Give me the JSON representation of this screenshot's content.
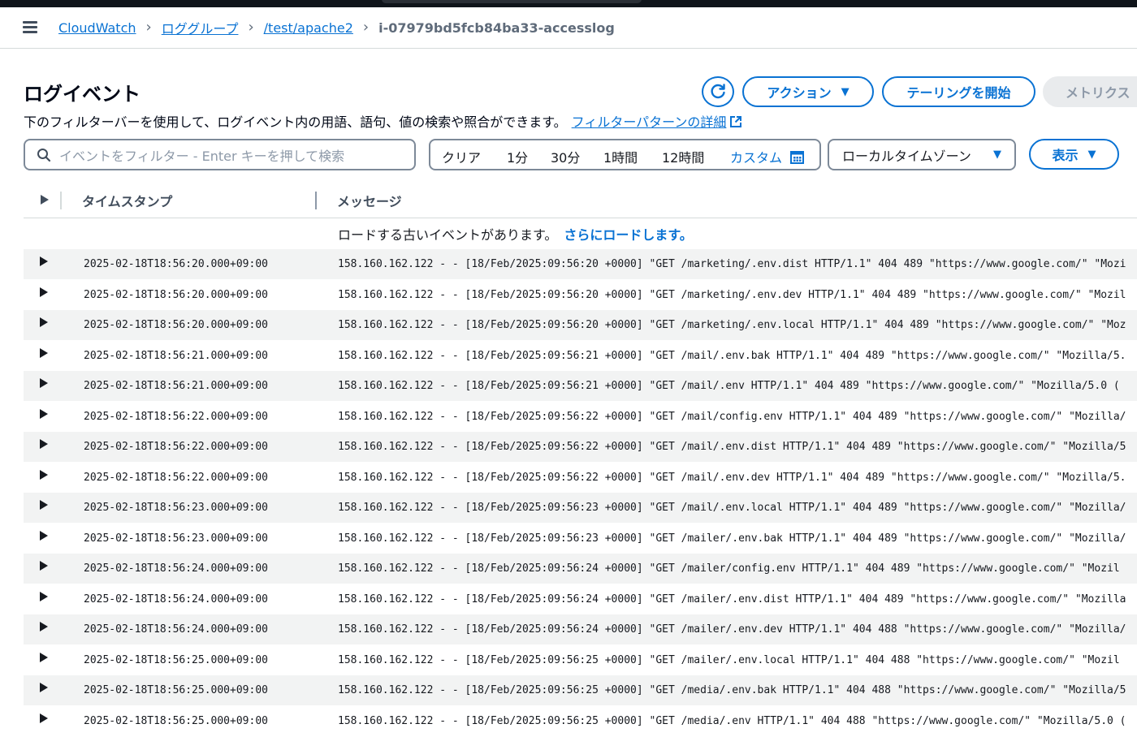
{
  "breadcrumb": {
    "items": [
      "CloudWatch",
      "ロググループ",
      "/test/apache2"
    ],
    "current": "i-07979bd5fcb84ba33-accesslog"
  },
  "page": {
    "title": "ログイベント",
    "description": "下のフィルターバーを使用して、ログイベント内の用語、語句、値の検索や照合ができます。",
    "filter_link": "フィルターパターンの詳細"
  },
  "toolbar": {
    "action_label": "アクション",
    "tail_label": "テーリングを開始",
    "metric_label": "メトリクス"
  },
  "filter": {
    "search_placeholder": "イベントをフィルター - Enter キーを押して検索",
    "range_options": [
      "クリア",
      "1分",
      "30分",
      "1時間",
      "12時間"
    ],
    "custom_label": "カスタム",
    "timezone": "ローカルタイムゾーン",
    "view_label": "表示"
  },
  "table": {
    "col_timestamp": "タイムスタンプ",
    "col_message": "メッセージ",
    "load_more_text": "ロードする古いイベントがあります。",
    "load_more_link": "さらにロードします。",
    "rows": [
      {
        "ts": "2025-02-18T18:56:20.000+09:00",
        "msg": "158.160.162.122 - - [18/Feb/2025:09:56:20 +0000] \"GET /marketing/.env.dist HTTP/1.1\" 404 489 \"https://www.google.com/\" \"Mozi"
      },
      {
        "ts": "2025-02-18T18:56:20.000+09:00",
        "msg": "158.160.162.122 - - [18/Feb/2025:09:56:20 +0000] \"GET /marketing/.env.dev HTTP/1.1\" 404 489 \"https://www.google.com/\" \"Mozil"
      },
      {
        "ts": "2025-02-18T18:56:20.000+09:00",
        "msg": "158.160.162.122 - - [18/Feb/2025:09:56:20 +0000] \"GET /marketing/.env.local HTTP/1.1\" 404 489 \"https://www.google.com/\" \"Moz"
      },
      {
        "ts": "2025-02-18T18:56:21.000+09:00",
        "msg": "158.160.162.122 - - [18/Feb/2025:09:56:21 +0000] \"GET /mail/.env.bak HTTP/1.1\" 404 489 \"https://www.google.com/\" \"Mozilla/5."
      },
      {
        "ts": "2025-02-18T18:56:21.000+09:00",
        "msg": "158.160.162.122 - - [18/Feb/2025:09:56:21 +0000] \"GET /mail/.env HTTP/1.1\" 404 489 \"https://www.google.com/\" \"Mozilla/5.0 ("
      },
      {
        "ts": "2025-02-18T18:56:22.000+09:00",
        "msg": "158.160.162.122 - - [18/Feb/2025:09:56:22 +0000] \"GET /mail/config.env HTTP/1.1\" 404 489 \"https://www.google.com/\" \"Mozilla/"
      },
      {
        "ts": "2025-02-18T18:56:22.000+09:00",
        "msg": "158.160.162.122 - - [18/Feb/2025:09:56:22 +0000] \"GET /mail/.env.dist HTTP/1.1\" 404 489 \"https://www.google.com/\" \"Mozilla/5"
      },
      {
        "ts": "2025-02-18T18:56:22.000+09:00",
        "msg": "158.160.162.122 - - [18/Feb/2025:09:56:22 +0000] \"GET /mail/.env.dev HTTP/1.1\" 404 489 \"https://www.google.com/\" \"Mozilla/5."
      },
      {
        "ts": "2025-02-18T18:56:23.000+09:00",
        "msg": "158.160.162.122 - - [18/Feb/2025:09:56:23 +0000] \"GET /mail/.env.local HTTP/1.1\" 404 489 \"https://www.google.com/\" \"Mozilla/"
      },
      {
        "ts": "2025-02-18T18:56:23.000+09:00",
        "msg": "158.160.162.122 - - [18/Feb/2025:09:56:23 +0000] \"GET /mailer/.env.bak HTTP/1.1\" 404 489 \"https://www.google.com/\" \"Mozilla/"
      },
      {
        "ts": "2025-02-18T18:56:24.000+09:00",
        "msg": "158.160.162.122 - - [18/Feb/2025:09:56:24 +0000] \"GET /mailer/config.env HTTP/1.1\" 404 489 \"https://www.google.com/\" \"Mozil"
      },
      {
        "ts": "2025-02-18T18:56:24.000+09:00",
        "msg": "158.160.162.122 - - [18/Feb/2025:09:56:24 +0000] \"GET /mailer/.env.dist HTTP/1.1\" 404 489 \"https://www.google.com/\" \"Mozilla"
      },
      {
        "ts": "2025-02-18T18:56:24.000+09:00",
        "msg": "158.160.162.122 - - [18/Feb/2025:09:56:24 +0000] \"GET /mailer/.env.dev HTTP/1.1\" 404 488 \"https://www.google.com/\" \"Mozilla/"
      },
      {
        "ts": "2025-02-18T18:56:25.000+09:00",
        "msg": "158.160.162.122 - - [18/Feb/2025:09:56:25 +0000] \"GET /mailer/.env.local HTTP/1.1\" 404 488 \"https://www.google.com/\" \"Mozil"
      },
      {
        "ts": "2025-02-18T18:56:25.000+09:00",
        "msg": "158.160.162.122 - - [18/Feb/2025:09:56:25 +0000] \"GET /media/.env.bak HTTP/1.1\" 404 488 \"https://www.google.com/\" \"Mozilla/5"
      },
      {
        "ts": "2025-02-18T18:56:25.000+09:00",
        "msg": "158.160.162.122 - - [18/Feb/2025:09:56:25 +0000] \"GET /media/.env HTTP/1.1\" 404 488 \"https://www.google.com/\" \"Mozilla/5.0 ("
      }
    ]
  },
  "colors": {
    "accent": "#0972d3",
    "header_dark": "#0f141a",
    "row_stripe": "#f2f3f3"
  },
  "icons": [
    "menu-icon",
    "refresh-icon",
    "caret-down-icon",
    "external-link-icon",
    "search-icon",
    "calendar-icon",
    "expand-triangle-icon"
  ]
}
